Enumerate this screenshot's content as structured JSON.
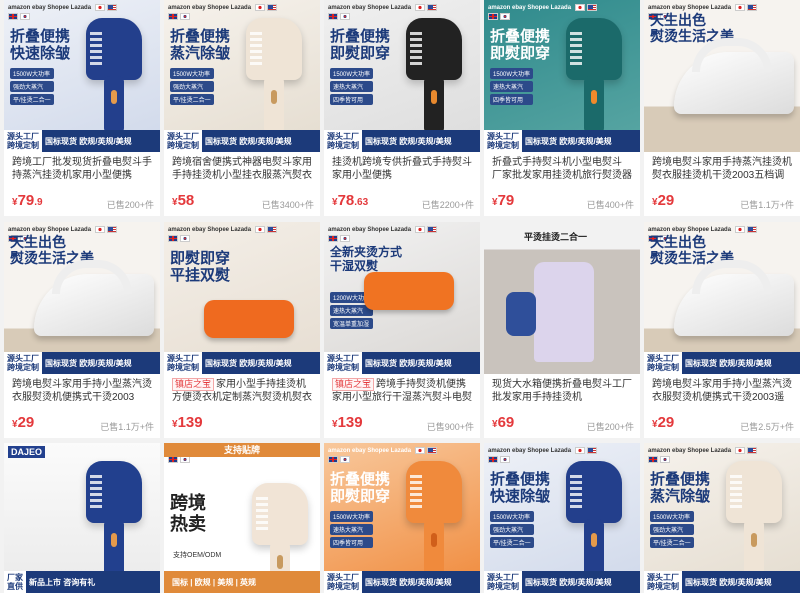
{
  "products": [
    {
      "headline": "折叠便携\n快速除皱",
      "chips": [
        "1500W大功率",
        "强劲大蒸汽",
        "平/挂烫二合一"
      ],
      "band_left": "源头工厂\n跨境定制",
      "band_right": "国标现货 欧规/英规/美规",
      "title_tag": "",
      "title": "跨境工厂批发现货折叠电熨斗手持蒸汽挂烫机家用小型便携",
      "tag2": "源头",
      "price_int": "79",
      "price_dec": ".9",
      "sold": "已售200+件",
      "theme": "blue"
    },
    {
      "headline": "折叠便携\n蒸汽除皱",
      "chips": [
        "1500W大功率",
        "强劲大蒸汽",
        "平/挂烫二合一"
      ],
      "band_left": "源头工厂\n跨境定制",
      "band_right": "国标现货 欧规/英规/美规",
      "title_tag": "",
      "title": "跨境宿舍便携式神器电熨斗家用手持挂烫机小型挂衣服蒸汽熨衣服",
      "tag2": "",
      "price_int": "58",
      "price_dec": "",
      "sold": "已售3400+件",
      "theme": "gold"
    },
    {
      "headline": "折叠便携\n即熨即穿",
      "chips": [
        "1500W大功率",
        "速热大蒸汽",
        "四季皆可用"
      ],
      "band_left": "源头工厂\n跨境定制",
      "band_right": "国标现货 欧规/英规/美规",
      "title_tag": "",
      "title": "挂烫机跨境专供折叠式手持熨斗家用小型便携",
      "tag2": "源头",
      "price_int": "78",
      "price_dec": ".63",
      "sold": "已售2200+件",
      "theme": "dark"
    },
    {
      "headline": "折叠便携\n即熨即穿",
      "chips": [
        "1500W大功率",
        "速热大蒸汽",
        "四季皆可用"
      ],
      "band_left": "源头工厂\n跨境定制",
      "band_right": "国标现货 欧规/英规/美规",
      "title_tag": "",
      "title": "折叠式手持熨斗机小型电熨斗 厂家批发家用挂烫机旅行熨烫器 蒸汽",
      "tag2": "",
      "price_int": "79",
      "price_dec": "",
      "sold": "已售400+件",
      "theme": "teal"
    },
    {
      "headline": "天生出色\n熨烫生活之美",
      "chips": [],
      "band_left": "",
      "band_right": "",
      "title_tag": "",
      "title": "跨境电熨斗家用手持蒸汽挂烫机熨衣服挂烫机干烫2003五档调温",
      "tag2": "",
      "price_int": "29",
      "price_dec": "",
      "sold": "已售1.1万+件",
      "theme": "iron"
    },
    {
      "headline": "天生出色\n熨烫生活之美",
      "chips": [],
      "band_left": "源头工厂\n跨境定制",
      "band_right": "国标现货 欧规/英规/美规",
      "title_tag": "",
      "title": "跨境电熨斗家用手持小型蒸汽烫衣服熨烫机便携式干烫2003",
      "tag2": "",
      "price_int": "29",
      "price_dec": "",
      "sold": "已售1.1万+件",
      "theme": "iron"
    },
    {
      "headline": "即熨即穿\n平挂双熨",
      "chips": [],
      "band_left": "源头工厂\n跨境定制",
      "band_right": "国标现货 欧规/英规/美规",
      "title_tag": "镇店之宝",
      "title": "家用小型手持挂烫机方便烫衣机定制蒸汽熨烫机熨衣服",
      "tag2": "",
      "price_int": "139",
      "price_dec": "",
      "sold": "",
      "theme": "orange"
    },
    {
      "headline": "全新夹烫方式\n干湿双熨",
      "chips": [
        "1200W大功率",
        "速热大蒸汽",
        "宽温单重加湿"
      ],
      "band_left": "源头工厂\n跨境定制",
      "band_right": "国标现货 欧规/英规/美规",
      "title_tag": "镇店之宝",
      "title": "跨境手持熨烫机便携家用小型旅行干湿蒸汽熨斗电熨斗挂烫",
      "tag2": "",
      "price_int": "139",
      "price_dec": "",
      "sold": "已售900+件",
      "theme": "orangeclip"
    },
    {
      "headline": "平烫挂烫二合一",
      "chips": [],
      "band_left": "",
      "band_right": "",
      "title_tag": "",
      "title": "现货大水箱便携折叠电熨斗工厂批发家用手持挂烫机",
      "tag2": "源头",
      "price_int": "69",
      "price_dec": "",
      "sold": "已售200+件",
      "theme": "photo"
    },
    {
      "headline": "天生出色\n熨烫生活之美",
      "chips": [],
      "band_left": "源头工厂\n跨境定制",
      "band_right": "国标现货 欧规/英规/美规",
      "title_tag": "",
      "title": "跨境电熨斗家用手持小型蒸汽烫衣服熨烫机便携式干烫2003遥控可",
      "tag2": "",
      "price_int": "29",
      "price_dec": "",
      "sold": "已售2.5万+件",
      "theme": "iron"
    },
    {
      "headline": "",
      "chips": [],
      "band_left": "厂家\n直供",
      "band_right": "新品上市 咨询有礼",
      "title_tag": "",
      "title": "",
      "tag2": "",
      "price_int": "",
      "price_dec": "",
      "sold": "",
      "theme": "dajeo"
    },
    {
      "headline": "跨境\n热卖",
      "chips": [
        "支持OEM/ODM"
      ],
      "band_left": "",
      "band_right": "国标 | 欧规 | 美规 | 英规",
      "title_tag": "支持贴牌",
      "title": "",
      "tag2": "",
      "price_int": "",
      "price_dec": "",
      "sold": "",
      "theme": "oem"
    },
    {
      "headline": "折叠便携\n即熨即穿",
      "chips": [
        "1500W大功率",
        "速热大蒸汽",
        "四季皆可用"
      ],
      "band_left": "源头工厂\n跨境定制",
      "band_right": "国标现货 欧规/英规/美规",
      "title_tag": "",
      "title": "",
      "tag2": "",
      "price_int": "",
      "price_dec": "",
      "sold": "",
      "theme": "orangefold"
    },
    {
      "headline": "折叠便携\n快速除皱",
      "chips": [
        "1500W大功率",
        "强劲大蒸汽",
        "平/挂烫二合一"
      ],
      "band_left": "源头工厂\n跨境定制",
      "band_right": "国标现货 欧规/英规/美规",
      "title_tag": "",
      "title": "",
      "tag2": "",
      "price_int": "",
      "price_dec": "",
      "sold": "",
      "theme": "blue"
    },
    {
      "headline": "折叠便携\n蒸汽除皱",
      "chips": [
        "1500W大功率",
        "强劲大蒸汽",
        "平/挂烫二合一"
      ],
      "band_left": "源头工厂\n跨境定制",
      "band_right": "国标现货 欧规/英规/美规",
      "title_tag": "",
      "title": "",
      "tag2": "",
      "price_int": "",
      "price_dec": "",
      "sold": "",
      "theme": "gold"
    }
  ],
  "dajeo_brand": "DAJEO",
  "yen": "¥",
  "brands": "amazon ebay Shopee Lazada"
}
